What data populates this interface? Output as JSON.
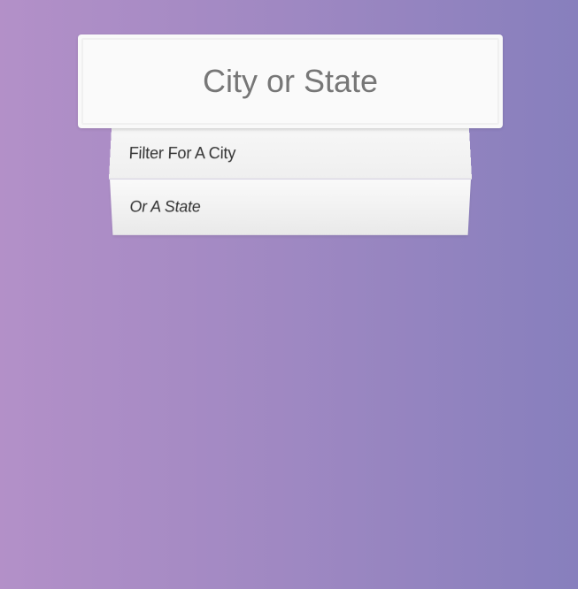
{
  "search": {
    "placeholder": "City or State"
  },
  "suggestions": [
    {
      "label": "Filter For A City"
    },
    {
      "label": "Or A State"
    }
  ]
}
